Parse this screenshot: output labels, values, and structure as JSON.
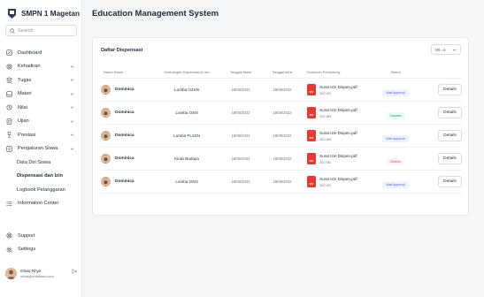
{
  "brand": {
    "name": "SMPN 1 Magetan",
    "icon": "school-logo-icon"
  },
  "search": {
    "placeholder": "Search",
    "value": ""
  },
  "nav": {
    "items": [
      {
        "label": "Dashboard",
        "icon": "dashboard-icon",
        "expandable": false
      },
      {
        "label": "Kehadiran",
        "icon": "attendance-icon",
        "expandable": true
      },
      {
        "label": "Tugas",
        "icon": "task-icon",
        "expandable": true
      },
      {
        "label": "Materi",
        "icon": "material-icon",
        "expandable": true
      },
      {
        "label": "Nilai",
        "icon": "grade-icon",
        "expandable": true
      },
      {
        "label": "Ujian",
        "icon": "exam-icon",
        "expandable": true
      },
      {
        "label": "Prestasi",
        "icon": "trophy-icon",
        "expandable": true
      },
      {
        "label": "Pengaturan Siswa",
        "icon": "student-settings-icon",
        "expandable": true,
        "expanded": true
      }
    ],
    "subitems": [
      {
        "label": "Data Diri Siswa",
        "active": false
      },
      {
        "label": "Dispensasi dan Izin",
        "active": true
      },
      {
        "label": "Logbook Pelanggaran",
        "active": false
      }
    ],
    "info": {
      "label": "Information Center",
      "icon": "info-list-icon"
    },
    "bottom": [
      {
        "label": "Support",
        "icon": "support-icon"
      },
      {
        "label": "Settings",
        "icon": "settings-icon"
      }
    ]
  },
  "user": {
    "name": "Olivia Rhye",
    "email": "olivia@untitledui.com"
  },
  "header": {
    "title": "Education Management System"
  },
  "card": {
    "title": "Daftar Dispensasi",
    "class_select": "VII - A"
  },
  "table": {
    "columns": [
      "Nama Siswa",
      "Keterangan Dispensasi & Izin",
      "Tanggal Mulai",
      "Tanggal Akhir",
      "Dokumen Pendukung",
      "Status"
    ],
    "action_label": "Details",
    "rows": [
      {
        "name": "Dominica",
        "keterangan": "Lomba O2SN",
        "mulai": "18/05/2022",
        "akhir": "18/05/2022",
        "doc": "Surat Izin Dispen.pdf",
        "size": "200 KB",
        "status": "Wait Approval"
      },
      {
        "name": "Dominica",
        "keterangan": "Lomba OSN",
        "mulai": "18/05/2022",
        "akhir": "18/05/2022",
        "doc": "Surat Izin Dispen.pdf",
        "size": "200 KB",
        "status": "Success"
      },
      {
        "name": "Dominica",
        "keterangan": "Lomba FLS2N",
        "mulai": "18/05/2022",
        "akhir": "18/05/2022",
        "doc": "Surat Izin Dispen.pdf",
        "size": "200 KB",
        "status": "Wait Approval"
      },
      {
        "name": "Dominica",
        "keterangan": "Kirab Budaya",
        "mulai": "18/05/2022",
        "akhir": "18/05/2022",
        "doc": "Surat Izin Dispen.pdf",
        "size": "200 KB",
        "status": "Decline"
      },
      {
        "name": "Dominica",
        "keterangan": "Lomba OSN",
        "mulai": "18/05/2022",
        "akhir": "18/05/2022",
        "doc": "Surat Izin Dispen.pdf",
        "size": "200 KB",
        "status": "Wait Approval"
      }
    ]
  },
  "pdf_label": "PDF",
  "colors": {
    "wait_bg": "#eef2ff",
    "wait_fg": "#4f6bd8",
    "success_bg": "#ecfdf3",
    "success_fg": "#12a150",
    "decline_bg": "#fef2f2",
    "decline_fg": "#e5484d",
    "pdf": "#e53935"
  }
}
